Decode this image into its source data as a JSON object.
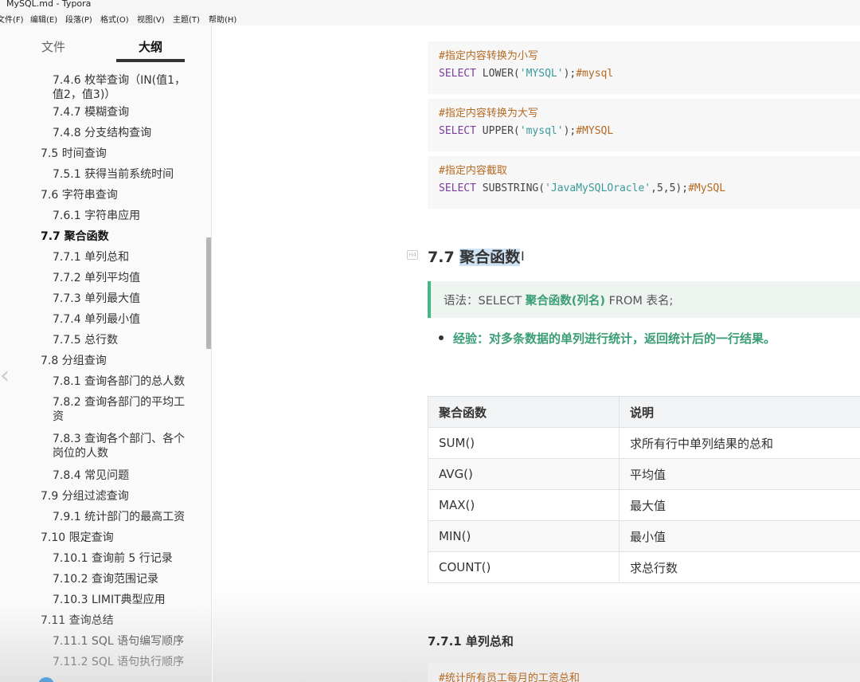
{
  "window": {
    "title": "MySQL.md - Typora"
  },
  "menu": [
    "文件(F)",
    "编辑(E)",
    "段落(P)",
    "格式(O)",
    "视图(V)",
    "主题(T)",
    "帮助(H)"
  ],
  "sidebar": {
    "tabs": {
      "files": "文件",
      "outline": "大纲"
    },
    "active_tab": "outline",
    "outline": [
      {
        "text": "7.4.6 枚举查询（IN(值1，值2，值3)）",
        "level": 3
      },
      {
        "text": "7.4.7 模糊查询",
        "level": 3
      },
      {
        "text": "7.4.8 分支结构查询",
        "level": 3
      },
      {
        "text": "7.5 时间查询",
        "level": 2
      },
      {
        "text": "7.5.1 获得当前系统时间",
        "level": 3
      },
      {
        "text": "7.6 字符串查询",
        "level": 2
      },
      {
        "text": "7.6.1 字符串应用",
        "level": 3
      },
      {
        "text": "7.7 聚合函数",
        "level": 2,
        "active": true
      },
      {
        "text": "7.7.1 单列总和",
        "level": 3
      },
      {
        "text": "7.7.2 单列平均值",
        "level": 3
      },
      {
        "text": "7.7.3 单列最大值",
        "level": 3
      },
      {
        "text": "7.7.4 单列最小值",
        "level": 3
      },
      {
        "text": "7.7.5 总行数",
        "level": 3
      },
      {
        "text": "7.8 分组查询",
        "level": 2
      },
      {
        "text": "7.8.1 查询各部门的总人数",
        "level": 3
      },
      {
        "text": "7.8.2 查询各部门的平均工资",
        "level": 3
      },
      {
        "text": "7.8.3 查询各个部门、各个岗位的人数",
        "level": 3
      },
      {
        "text": "7.8.4 常见问题",
        "level": 3
      },
      {
        "text": "7.9 分组过滤查询",
        "level": 2
      },
      {
        "text": "7.9.1 统计部门的最高工资",
        "level": 3
      },
      {
        "text": "7.10 限定查询",
        "level": 2
      },
      {
        "text": "7.10.1 查询前 5 行记录",
        "level": 3
      },
      {
        "text": "7.10.2 查询范围记录",
        "level": 3
      },
      {
        "text": "7.10.3 LIMIT典型应用",
        "level": 3
      },
      {
        "text": "7.11 查询总结",
        "level": 2
      },
      {
        "text": "7.11.1 SQL 语句编写顺序",
        "level": 3
      },
      {
        "text": "7.11.2 SQL 语句执行顺序",
        "level": 3
      }
    ]
  },
  "editor": {
    "code_blocks": [
      {
        "comment": "#指定内容转换为小写",
        "kw": "SELECT",
        "fn": " LOWER(",
        "str": "'MYSQL'",
        "rest": ");",
        "tail": "#mysql"
      },
      {
        "comment": "#指定内容转换为大写",
        "kw": "SELECT",
        "fn": " UPPER(",
        "str": "'mysql'",
        "rest": ");",
        "tail": "#MYSQL"
      },
      {
        "comment": "#指定内容截取",
        "kw": "SELECT",
        "fn": " SUBSTRING(",
        "str": "'JavaMySQLOracle'",
        "rest": ",5,5);",
        "tail": "#MySQL"
      }
    ],
    "heading": {
      "number": "7.7 ",
      "title": "聚合函数"
    },
    "quote": {
      "prefix": "语法：SELECT ",
      "strong": "聚合函数(列名)",
      "suffix": " FROM 表名;"
    },
    "bullet": "经验：对多条数据的单列进行统计，返回统计后的一行结果。",
    "table": {
      "headers": [
        "聚合函数",
        "说明"
      ],
      "rows": [
        [
          "SUM()",
          "求所有行中单列结果的总和"
        ],
        [
          "AVG()",
          "平均值"
        ],
        [
          "MAX()",
          "最大值"
        ],
        [
          "MIN()",
          "最小值"
        ],
        [
          "COUNT()",
          "求总行数"
        ]
      ]
    },
    "subheading": "7.7.1 单列总和",
    "bottom_code_comment": "#统计所有员工每月的工资总和"
  },
  "colors": {
    "accent": "#42b983",
    "code_comment": "#b56a23",
    "code_keyword": "#7a3e9d",
    "code_string": "#3a9a9a"
  }
}
